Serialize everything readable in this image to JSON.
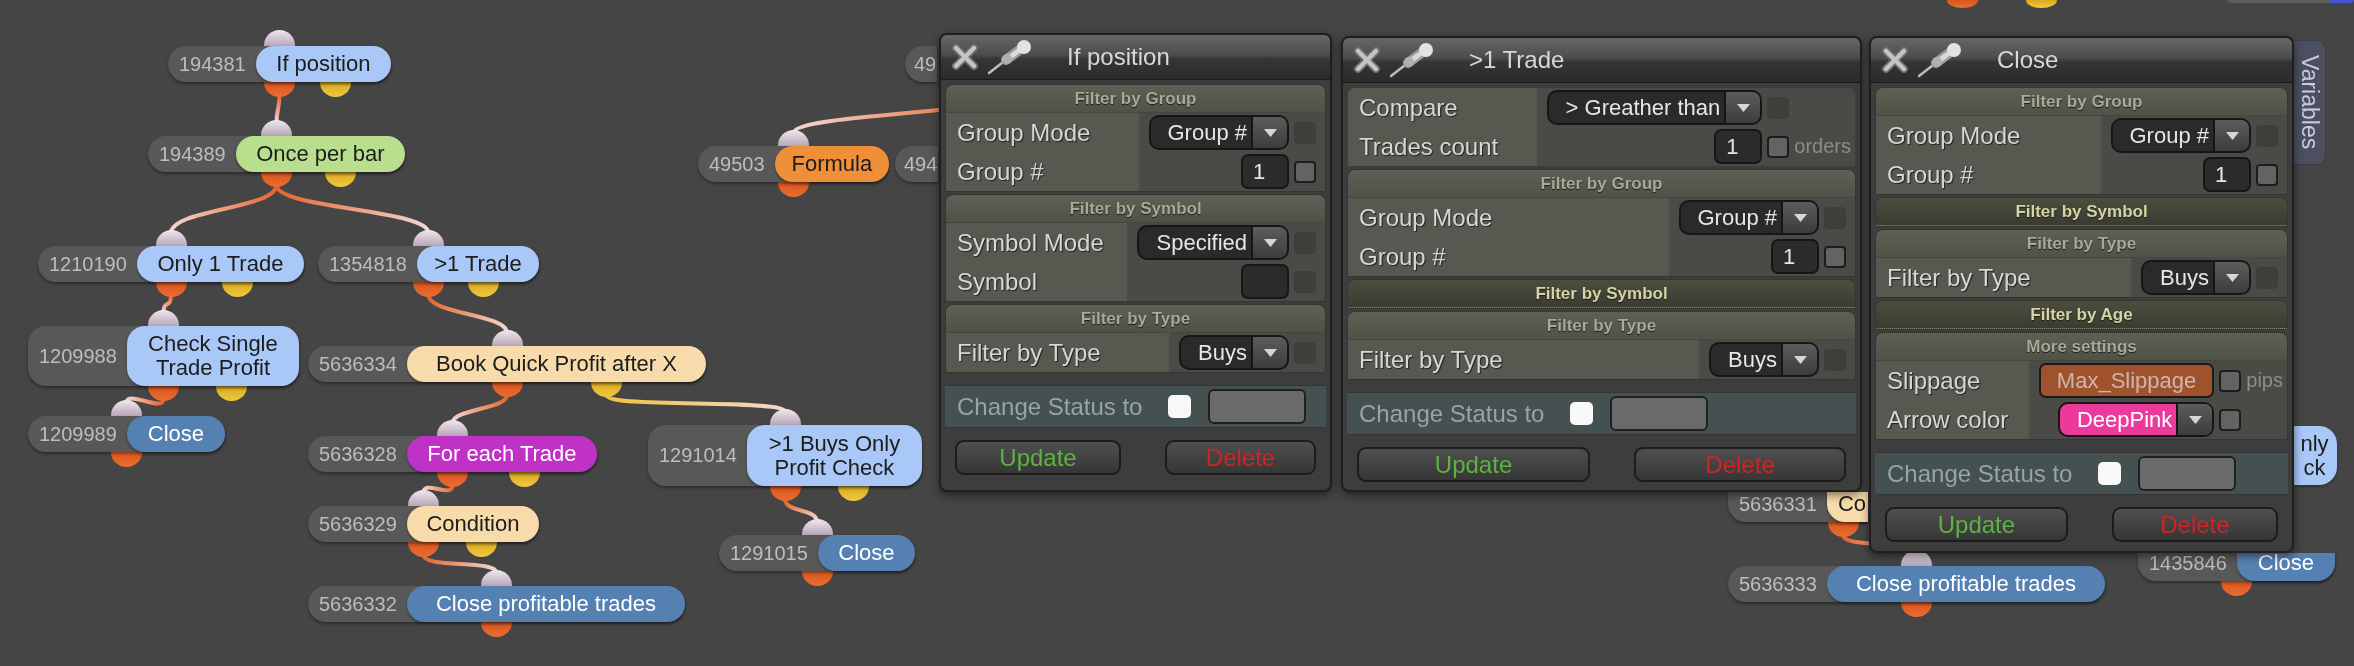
{
  "canvas": {
    "nodes": [
      {
        "id": "194381",
        "label": "If position",
        "color": "#a9c7f7",
        "kind": "condition",
        "children": [
          {
            "id": "194389",
            "label": "Once per bar",
            "color": "#b9de8d",
            "kind": "condition",
            "from_secondary_output": false,
            "children": [
              {
                "id": "1210190",
                "label": "Only 1 Trade",
                "color": "#a9c7f7",
                "kind": "condition",
                "from_secondary_output": false,
                "children": [
                  {
                    "id": "1209988",
                    "label": "Check Single Trade Profit",
                    "color": "#a9c7f7",
                    "kind": "condition",
                    "from_secondary_output": false,
                    "children": [
                      {
                        "id": "1209989",
                        "label": "Close",
                        "color": "#5581b2",
                        "kind": "action",
                        "from_secondary_output": false
                      }
                    ]
                  }
                ]
              },
              {
                "id": "1354818",
                "label": ">1 Trade",
                "color": "#a9c7f7",
                "kind": "condition",
                "from_secondary_output": false,
                "children": [
                  {
                    "id": "5636334",
                    "label": "Book Quick Profit after X",
                    "color": "#f8dbab",
                    "kind": "condition",
                    "from_secondary_output": false,
                    "children": [
                      {
                        "id": "5636328",
                        "label": "For each Trade",
                        "color": "#c031c6",
                        "kind": "condition",
                        "from_secondary_output": false,
                        "children": [
                          {
                            "id": "5636329",
                            "label": "Condition",
                            "color": "#f8dbab",
                            "kind": "condition",
                            "from_secondary_output": false,
                            "children": [
                              {
                                "id": "5636332",
                                "label": "Close profitable trades",
                                "color": "#5581b2",
                                "from_secondary_output": false
                              }
                            ]
                          }
                        ]
                      },
                      {
                        "id": "1291014",
                        "label": ">1 Buys Only Profit Check",
                        "color": "#a9c7f7",
                        "kind": "condition",
                        "from_secondary_output": true,
                        "children": [
                          {
                            "id": "1291015",
                            "label": "Close",
                            "color": "#5581b2",
                            "kind": "action",
                            "from_secondary_output": false
                          }
                        ]
                      }
                    ]
                  }
                ]
              }
            ]
          }
        ]
      },
      {
        "id": "49",
        "children": [
          {
            "id": "49503",
            "label": "Formula",
            "color": "#ef8f3a",
            "kind": "action",
            "from_secondary_output": false
          }
        ]
      },
      {
        "id": "494"
      },
      {
        "id": "5636331",
        "label": "Co",
        "color": "#f8dbab",
        "children": [
          {
            "id": "5636333",
            "label": "Close profitable trades",
            "color": "#5581b2",
            "kind": "action",
            "from_secondary_output": false
          }
        ]
      },
      {
        "label": "nly ck",
        "color": "#a9c7f7"
      },
      {
        "id": "1435846",
        "label": "Close",
        "color": "#5581b2",
        "kind": "action"
      }
    ]
  },
  "panels": [
    {
      "title": "If position",
      "sections": [
        {
          "title": "Filter by Group",
          "expanded": true,
          "rows": [
            {
              "label": "Group Mode",
              "kind": "select",
              "value": "Group #",
              "checked": false,
              "disabled": true
            },
            {
              "label": "Group #",
              "kind": "number",
              "value": "1",
              "checked": false,
              "disabled": false
            }
          ]
        },
        {
          "title": "Filter by Symbol",
          "expanded": true,
          "rows": [
            {
              "label": "Symbol Mode",
              "kind": "select",
              "value": "Specified",
              "checked": false,
              "disabled": true
            },
            {
              "label": "Symbol",
              "kind": "text",
              "checked": false,
              "disabled": true
            }
          ]
        },
        {
          "title": "Filter by Type",
          "expanded": true,
          "rows": [
            {
              "label": "Filter by Type",
              "kind": "select",
              "value": "Buys",
              "checked": false,
              "disabled": true
            }
          ]
        }
      ],
      "status": {
        "label": "Change Status to",
        "checked": false
      },
      "buttons": [
        {
          "label": "Update",
          "kind": "update"
        },
        {
          "label": "Delete",
          "kind": "delete"
        }
      ]
    },
    {
      "title": ">1 Trade",
      "sections": [
        {
          "rows": [
            {
              "label": "Compare",
              "kind": "select",
              "value": "> Greather than",
              "checked": false,
              "disabled": true
            },
            {
              "label": "Trades count",
              "kind": "number",
              "value": "1",
              "unit": "orders",
              "checked": false,
              "disabled": false
            }
          ]
        },
        {
          "title": "Filter by Group",
          "expanded": true,
          "rows": [
            {
              "label": "Group Mode",
              "kind": "select",
              "value": "Group #",
              "checked": false,
              "disabled": true
            },
            {
              "label": "Group #",
              "kind": "number",
              "value": "1",
              "checked": false,
              "disabled": false
            }
          ]
        },
        {
          "title": "Filter by Symbol",
          "expanded": false
        },
        {
          "title": "Filter by Type",
          "expanded": true,
          "rows": [
            {
              "label": "Filter by Type",
              "kind": "select",
              "value": "Buys",
              "checked": false,
              "disabled": true
            }
          ]
        }
      ],
      "status": {
        "label": "Change Status to",
        "checked": false
      },
      "buttons": [
        {
          "label": "Update",
          "kind": "update"
        },
        {
          "label": "Delete",
          "kind": "delete"
        }
      ]
    },
    {
      "title": "Close",
      "sections": [
        {
          "title": "Filter by Group",
          "expanded": true,
          "rows": [
            {
              "label": "Group Mode",
              "kind": "select",
              "value": "Group #",
              "checked": false,
              "disabled": true
            },
            {
              "label": "Group #",
              "kind": "number",
              "value": "1",
              "checked": false,
              "disabled": false
            }
          ]
        },
        {
          "title": "Filter by Symbol",
          "expanded": false
        },
        {
          "title": "Filter by Type",
          "expanded": true,
          "rows": [
            {
              "label": "Filter by Type",
              "kind": "select",
              "value": "Buys",
              "checked": false,
              "disabled": true
            }
          ]
        },
        {
          "title": "Filter by Age",
          "expanded": false
        },
        {
          "title": "More settings",
          "expanded": true,
          "rows": [
            {
              "label": "Slippage",
              "kind": "variable",
              "value": "Max_Slippage",
              "unit": "pips",
              "checked": false,
              "disabled": false
            },
            {
              "label": "Arrow color",
              "kind": "color",
              "value": "DeepPink",
              "color": "#eb3a9c",
              "checked": false,
              "disabled": false
            }
          ]
        }
      ],
      "status": {
        "label": "Change Status to",
        "checked": false
      },
      "buttons": [
        {
          "label": "Update",
          "kind": "update"
        },
        {
          "label": "Delete",
          "kind": "delete"
        }
      ]
    }
  ],
  "side_tab": {
    "label": "Variables"
  }
}
